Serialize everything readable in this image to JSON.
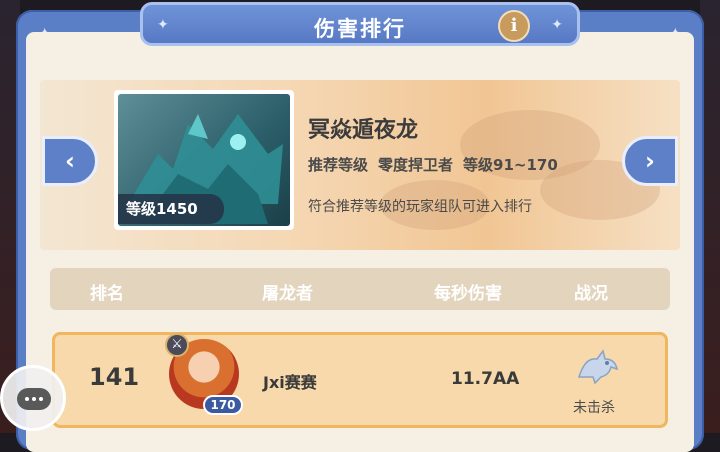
{
  "header": {
    "title": "伤害排行",
    "info_icon": "info-icon",
    "info_glyph": "i"
  },
  "boss": {
    "name": "冥焱遁夜龙",
    "level_badge": "等级1450",
    "recommend_label": "推荐等级",
    "recommend_tier": "零度捍卫者",
    "recommend_range": "等级91~170",
    "note": "符合推荐等级的玩家组队可进入排行",
    "prev_icon": "chevron-left-icon",
    "next_icon": "chevron-right-icon",
    "prev_glyph": "‹",
    "next_glyph": "›"
  },
  "table": {
    "headers": {
      "rank": "排名",
      "player": "屠龙者",
      "damage": "每秒伤害",
      "status": "战况"
    },
    "rows": [
      {
        "rank": "141",
        "player": "Jxi赛赛",
        "level": "170",
        "damage": "11.7AA",
        "status": "未击杀"
      }
    ]
  },
  "chat": {
    "icon": "chat-icon"
  },
  "colors": {
    "accent_blue": "#5b7fc6",
    "panel_bg": "#f6efe4",
    "row_highlight": "#f7d9ab",
    "row_border": "#f0b760"
  }
}
